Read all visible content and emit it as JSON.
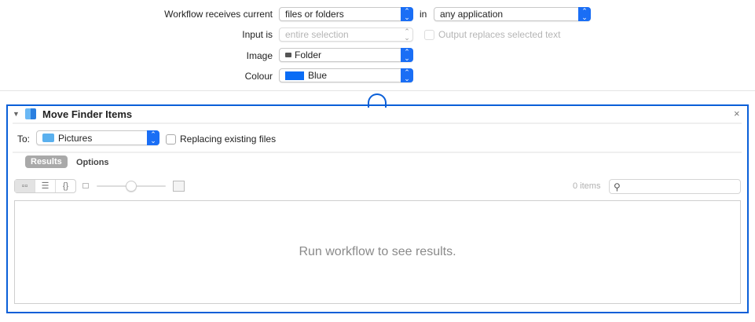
{
  "workflow": {
    "receives_label": "Workflow receives current",
    "receives_value": "files or folders",
    "in_label": "in",
    "application_value": "any application",
    "input_label": "Input is",
    "input_value": "entire selection",
    "output_replaces_label": "Output replaces selected text",
    "image_label": "Image",
    "image_value": "Folder",
    "colour_label": "Colour",
    "colour_value": "Blue",
    "colour_swatch": "#0a6cf5"
  },
  "action": {
    "title": "Move Finder Items",
    "close": "×",
    "to_label": "To:",
    "to_value": "Pictures",
    "replacing_label": "Replacing existing files",
    "tabs": [
      "Results",
      "Options"
    ],
    "view_buttons": [
      "icon-view",
      "list-view",
      "json-view"
    ],
    "items_count": "0 items",
    "search_placeholder": "",
    "empty_message": "Run workflow to see results."
  },
  "accent": "#0a5fd8"
}
